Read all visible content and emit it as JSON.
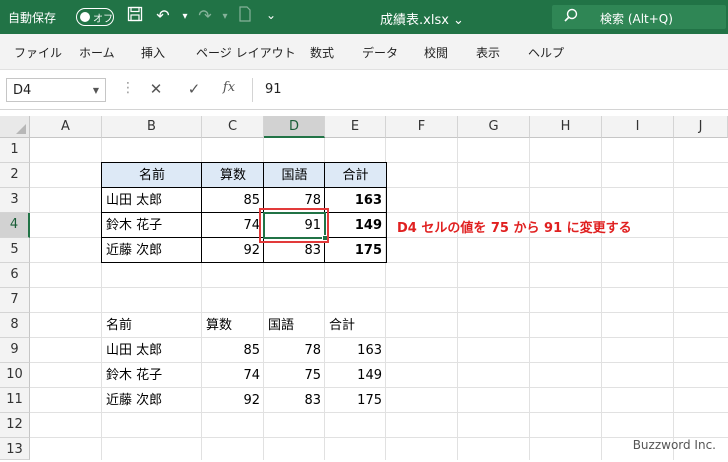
{
  "titlebar": {
    "autosave_label": "自動保存",
    "toggle_text": "オフ",
    "filename": "成績表.xlsx",
    "search_label": "検索 (Alt+Q)",
    "bg_color": "#217346"
  },
  "menu": [
    "ファイル",
    "ホーム",
    "挿入",
    "ページ レイアウト",
    "数式",
    "データ",
    "校閲",
    "表示",
    "ヘルプ"
  ],
  "formula_bar": {
    "name_box": "D4",
    "fx_label": "fx",
    "value": "91"
  },
  "columns": [
    "A",
    "B",
    "C",
    "D",
    "E",
    "F",
    "G",
    "H",
    "I",
    "J"
  ],
  "rows": [
    "1",
    "2",
    "3",
    "4",
    "5",
    "6",
    "7",
    "8",
    "9",
    "10",
    "11",
    "12",
    "13"
  ],
  "selected_cell": "D4",
  "table1": {
    "headers": [
      "名前",
      "算数",
      "国語",
      "合計"
    ],
    "rows": [
      [
        "山田 太郎",
        "85",
        "78",
        "163"
      ],
      [
        "鈴木 花子",
        "74",
        "91",
        "149"
      ],
      [
        "近藤 次郎",
        "92",
        "83",
        "175"
      ]
    ]
  },
  "table2": {
    "headers": [
      "名前",
      "算数",
      "国語",
      "合計"
    ],
    "rows": [
      [
        "山田 太郎",
        "85",
        "78",
        "163"
      ],
      [
        "鈴木 花子",
        "74",
        "75",
        "149"
      ],
      [
        "近藤 次郎",
        "92",
        "83",
        "175"
      ]
    ]
  },
  "annotation": "D4 セルの値を 75 から 91 に変更する",
  "watermark": "Buzzword Inc."
}
